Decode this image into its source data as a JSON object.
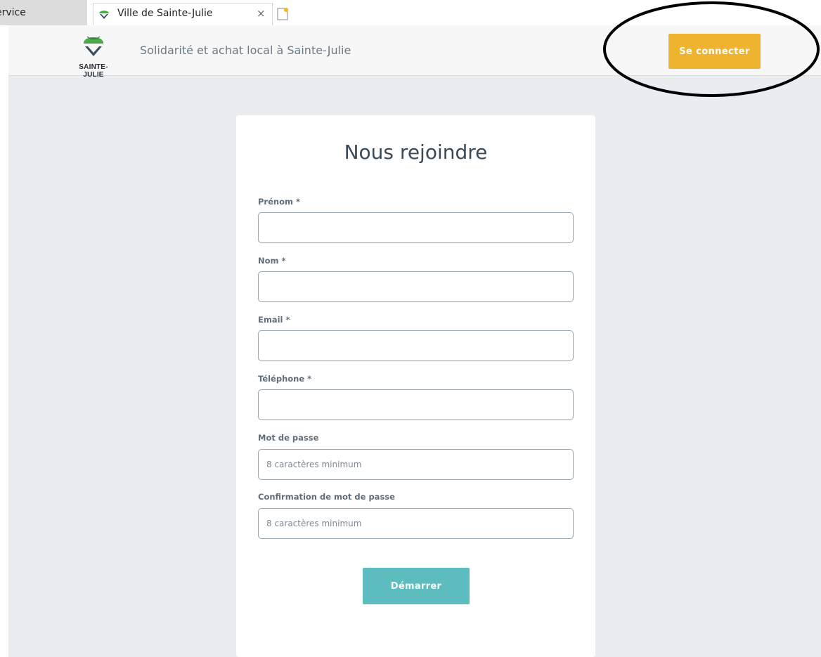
{
  "browser": {
    "prev_tab_title": "ervice",
    "active_tab_title": "Ville de Sainte-Julie",
    "close_glyph": "×"
  },
  "header": {
    "logo_text": "SAINTE-JULIE",
    "site_title": "Solidarité et achat local à Sainte-Julie",
    "login_label": "Se connecter"
  },
  "form": {
    "title": "Nous rejoindre",
    "fields": [
      {
        "label": "Prénom *",
        "value": "",
        "placeholder": ""
      },
      {
        "label": "Nom *",
        "value": "",
        "placeholder": ""
      },
      {
        "label": "Email *",
        "value": "",
        "placeholder": ""
      },
      {
        "label": "Téléphone *",
        "value": "",
        "placeholder": ""
      },
      {
        "label": "Mot de passe",
        "value": "",
        "placeholder": "8 caractères minimum"
      },
      {
        "label": "Confirmation de mot de passe",
        "value": "",
        "placeholder": "8 caractères minimum"
      }
    ],
    "submit_label": "Démarrer"
  },
  "colors": {
    "login_button": "#eeb32f",
    "submit_button": "#5dbcbd",
    "page_background": "#e9edf0",
    "logo_green": "#4aa84a"
  },
  "icons": {
    "tab_favicon": "sainte-julie-logo-icon",
    "tab_close": "close-icon",
    "new_tab": "new-tab-icon"
  }
}
